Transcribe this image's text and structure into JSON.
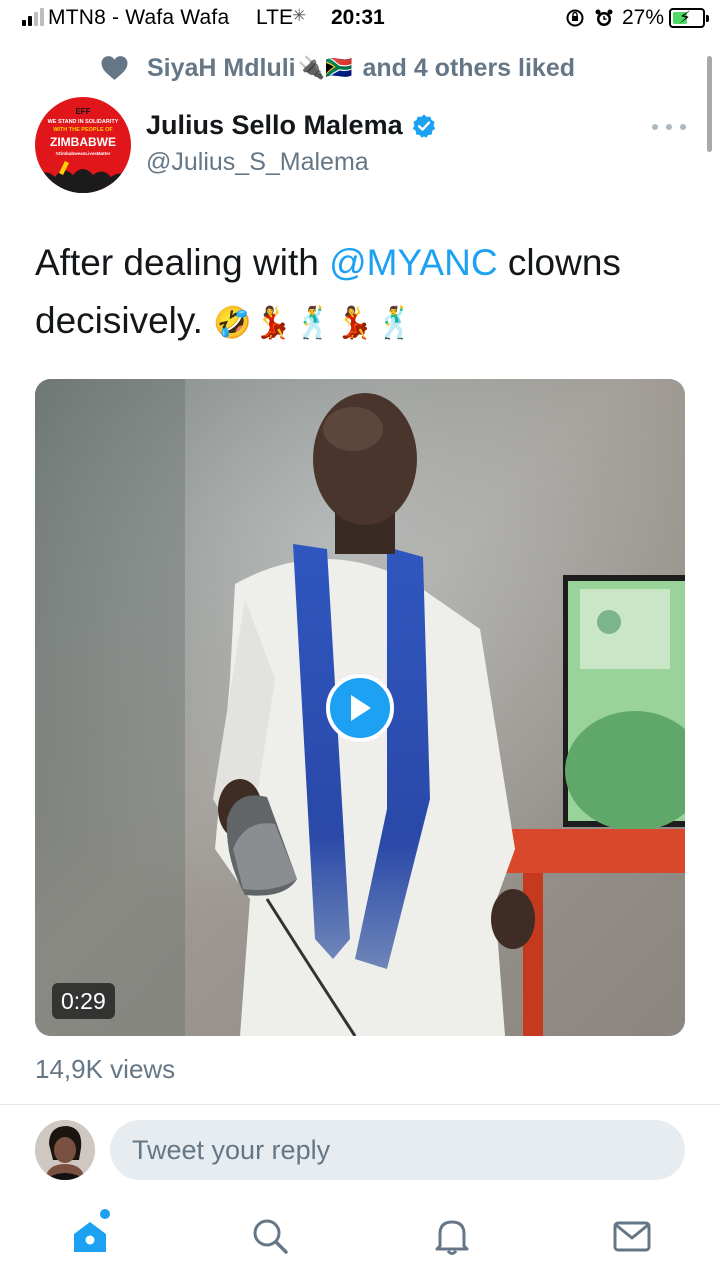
{
  "status_bar": {
    "carrier": "MTN8 - Wafa Wafa",
    "network": "LTE",
    "time": "20:31",
    "battery_percent": "27%",
    "battery_level": 0.27,
    "signal_bars_filled": 2,
    "signal_bars_total": 4
  },
  "social_context": {
    "liker_name": "SiyaH Mdluli",
    "liker_emoji": "🔌🇿🇦",
    "rest": "and 4 others liked",
    "icon": "heart-icon"
  },
  "author": {
    "display_name": "Julius Sello Malema",
    "handle": "@Julius_S_Malema",
    "verified": true,
    "avatar_text": {
      "org": "EFF",
      "line1": "WE STAND IN SOLIDARITY",
      "line2": "WITH THE PEOPLE OF",
      "line3": "ZIMBABWE",
      "line4": "#ZimbabweanLivesMatter"
    }
  },
  "tweet": {
    "text_before": "After dealing with ",
    "mention": "@MYANC",
    "text_after": " clowns decisively. ",
    "emoji": "🤣💃🕺💃🕺"
  },
  "media": {
    "type": "video",
    "duration": "0:29",
    "play_icon": "play-icon"
  },
  "stats": {
    "views": "14,9K views"
  },
  "reply": {
    "placeholder": "Tweet your reply"
  },
  "tab_bar": {
    "tabs": [
      "home-icon",
      "search-icon",
      "notifications-icon",
      "messages-icon"
    ],
    "active": "home-icon"
  },
  "colors": {
    "accent": "#1da1f2",
    "secondary_text": "#657786",
    "primary_text": "#14171a",
    "reply_bg": "#e6ecf0",
    "divider": "#e1e8ed"
  }
}
